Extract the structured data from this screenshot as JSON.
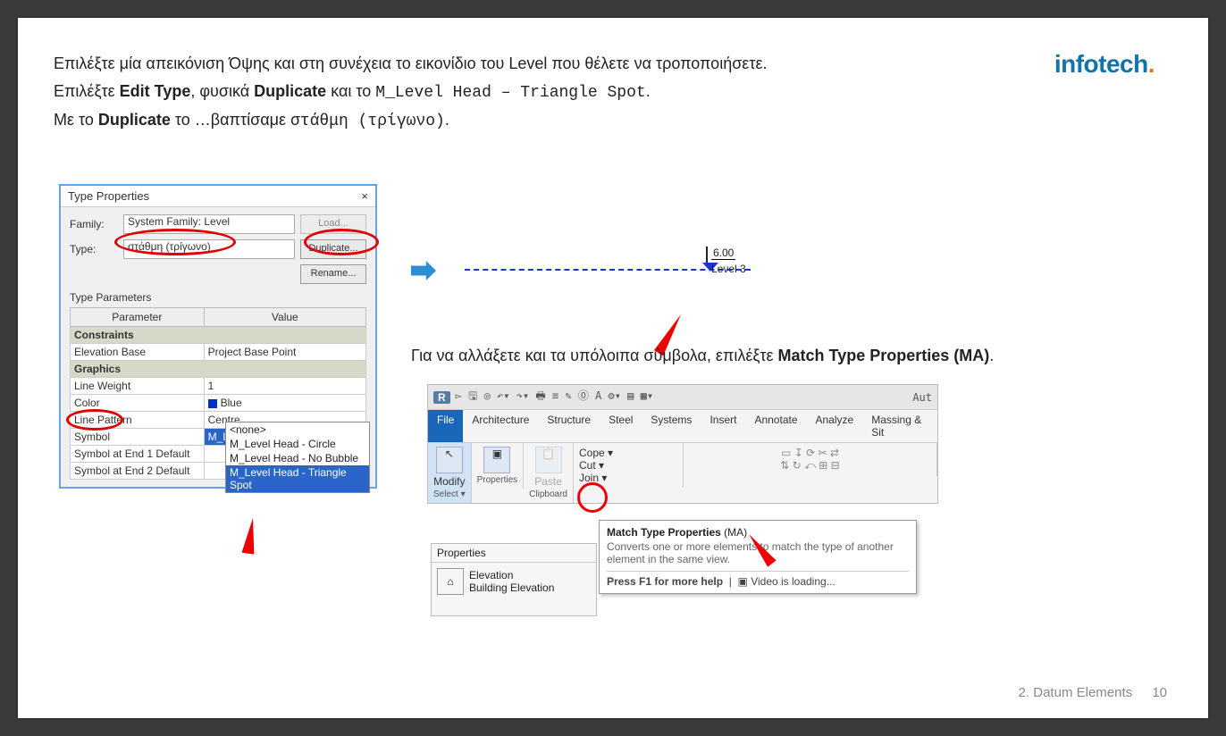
{
  "logo": {
    "brand": "infotech",
    "dot": "."
  },
  "intro": {
    "l1a": "Επιλέξτε μία απεικόνιση Όψης και στη συνέχεια το εικονίδιο του Level που θέλετε να τροποποιήσετε.",
    "l2a": "Επιλέξτε ",
    "l2b": "Edit Type",
    "l2c": ", φυσικά ",
    "l2d": "Duplicate",
    "l2e": " και το ",
    "l2f": "M_Level Head – Triangle Spot",
    "l2g": ".",
    "l3a": "Με το ",
    "l3b": "Duplicate",
    "l3c": " το …βαπτίσαμε ",
    "l3d": "στάθμη (τρίγωνο)",
    "l3e": "."
  },
  "dlg": {
    "title": "Type Properties",
    "close": "×",
    "family_lbl": "Family:",
    "family": "System Family: Level",
    "type_lbl": "Type:",
    "type": "στάθμη (τρίγωνο)",
    "btn_load": "Load...",
    "btn_dup": "Duplicate...",
    "btn_ren": "Rename...",
    "params_lbl": "Type Parameters",
    "col_param": "Parameter",
    "col_val": "Value",
    "grp1": "Constraints",
    "r1p": "Elevation Base",
    "r1v": "Project Base Point",
    "grp2": "Graphics",
    "r2p": "Line Weight",
    "r2v": "1",
    "r3p": "Color",
    "r3v": "Blue",
    "r4p": "Line Pattern",
    "r4v": "Centre",
    "r5p": "Symbol",
    "r5v": "M_Level Head - Triangle Spot",
    "r6p": "Symbol at End 1 Default",
    "r6v": "",
    "r7p": "Symbol at End 2 Default",
    "r7v": "",
    "dd": {
      "o0": "<none>",
      "o1": "M_Level Head - Circle",
      "o2": "M_Level Head - No Bubble",
      "o3": "M_Level Head - Triangle Spot"
    }
  },
  "level": {
    "value": "6.00",
    "name": "Level 3"
  },
  "caption2a": "Για να αλλάξετε και τα υπόλοιπα σύμβολα, επιλέξτε ",
  "caption2b": "Match Type Properties (MA)",
  "caption2c": ".",
  "ribbon": {
    "auto": "Aut",
    "tabs": {
      "file": "File",
      "arch": "Architecture",
      "struct": "Structure",
      "steel": "Steel",
      "sys": "Systems",
      "ins": "Insert",
      "ann": "Annotate",
      "ana": "Analyze",
      "mass": "Massing & Sit"
    },
    "modify": "Modify",
    "select": "Select ▾",
    "props": "Properties",
    "clip": "Clipboard",
    "paste": "Paste",
    "cope": "Cope ▾",
    "cut": "Cut ▾",
    "join": "Join ▾"
  },
  "tooltip": {
    "t1": "Match Type Properties",
    "t1s": " (MA)",
    "t2": "Converts one or more elements to match the type of another element in the same view.",
    "t3": "Press F1 for more help",
    "t4": "Video is loading..."
  },
  "proppal": {
    "title": "Properties",
    "line1": "Elevation",
    "line2": "Building Elevation"
  },
  "footer": {
    "section": "2. Datum Elements",
    "page": "10"
  }
}
